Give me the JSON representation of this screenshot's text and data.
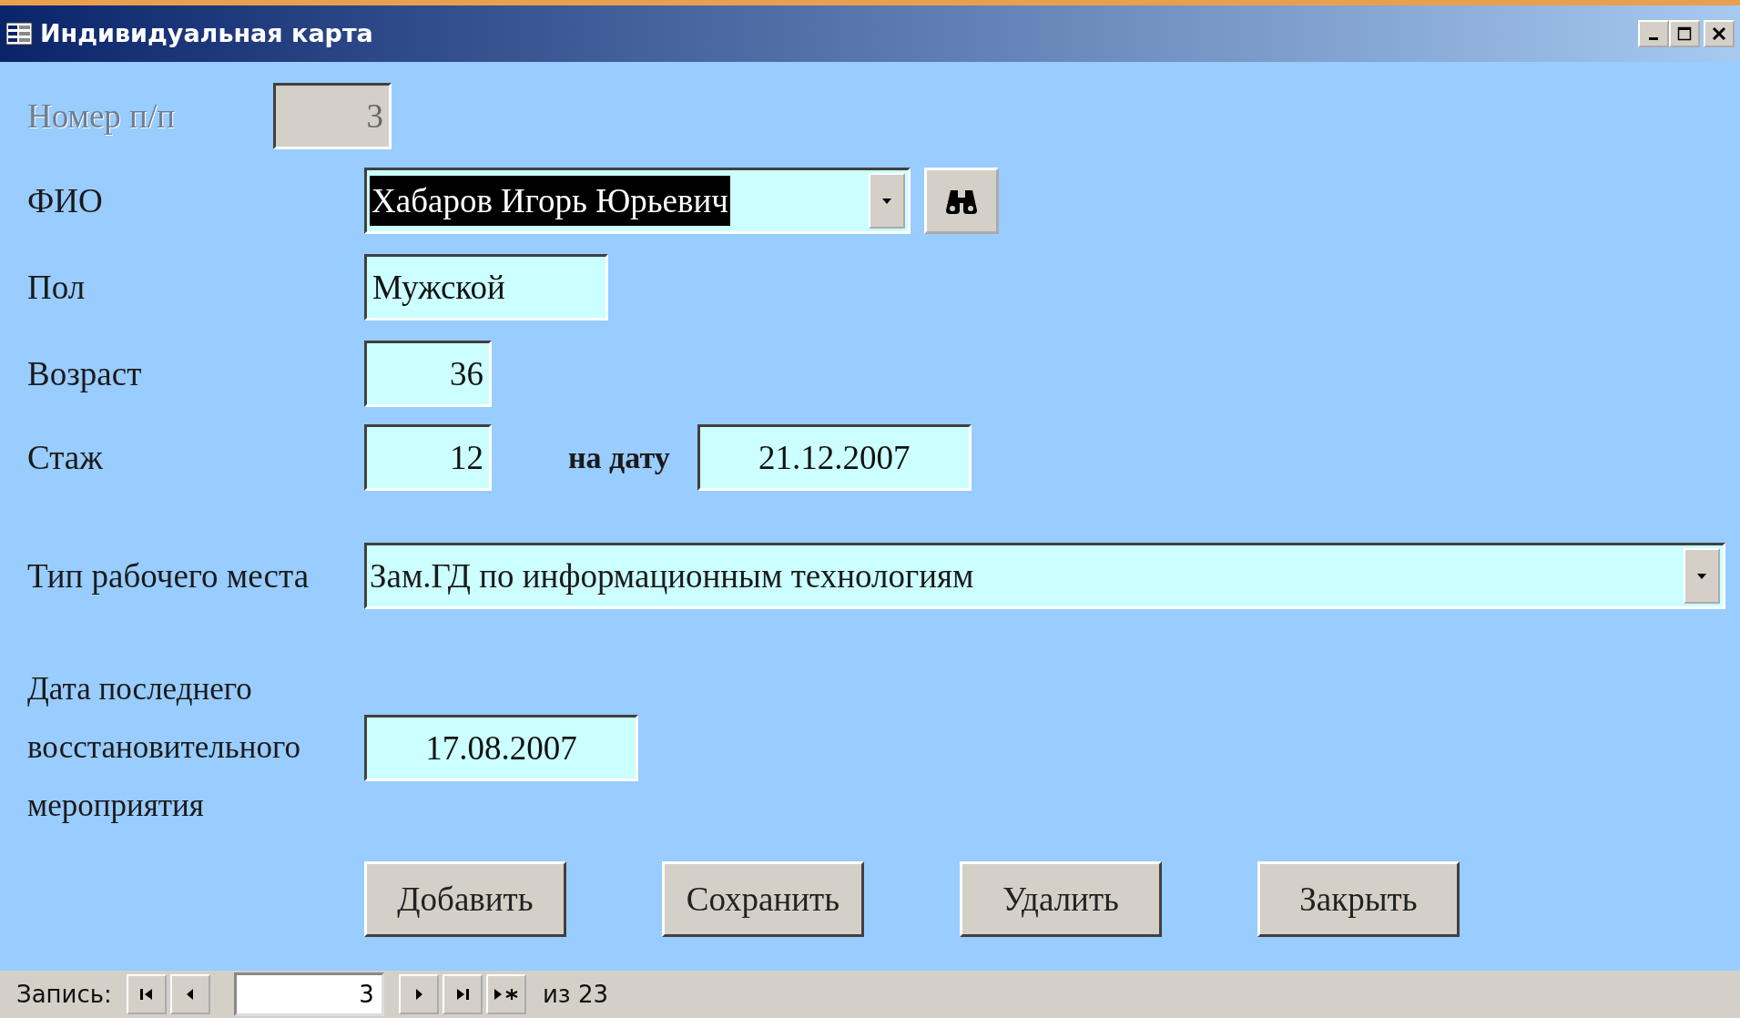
{
  "window": {
    "title": "Индивидуальная карта"
  },
  "form": {
    "number": {
      "label": "Номер п/п",
      "value": "3",
      "disabled": true
    },
    "fio": {
      "label": "ФИО",
      "value": "Хабаров Игорь Юрьевич",
      "highlighted": true
    },
    "sex": {
      "label": "Пол",
      "value": "Мужской"
    },
    "age": {
      "label": "Возраст",
      "value": "36"
    },
    "experience": {
      "label": "Стаж",
      "value": "12",
      "date_label": "на дату",
      "date_value": "21.12.2007"
    },
    "workplace_type": {
      "label": "Тип рабочего места",
      "value": "Зам.ГД по информационным технологиям"
    },
    "last_rehab_date": {
      "label": "Дата последнего восстановительного мероприятия",
      "value": "17.08.2007"
    }
  },
  "buttons": [
    "Добавить",
    "Сохранить",
    "Удалить",
    "Закрыть"
  ],
  "record_nav": {
    "label": "Запись:",
    "current": "3",
    "total": "из 23"
  }
}
